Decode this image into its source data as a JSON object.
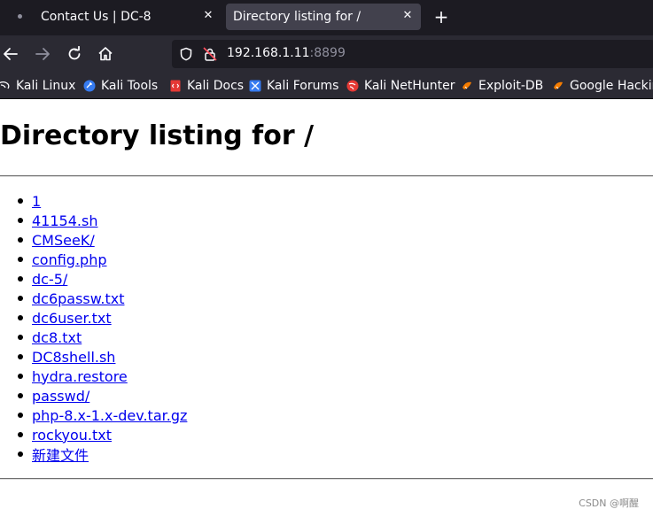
{
  "tabs": [
    {
      "label": "Contact Us | DC-8",
      "active": false
    },
    {
      "label": "Directory listing for /",
      "active": true
    }
  ],
  "nav": {
    "url_host": "192.168.1.11",
    "url_port": ":8899"
  },
  "bookmarks": [
    {
      "label": "Kali Linux",
      "icon": "kali-dragon-icon"
    },
    {
      "label": "Kali Tools",
      "icon": "kali-tools-icon"
    },
    {
      "label": "Kali Docs",
      "icon": "kali-docs-icon"
    },
    {
      "label": "Kali Forums",
      "icon": "kali-forums-icon"
    },
    {
      "label": "Kali NetHunter",
      "icon": "kali-nethunter-icon"
    },
    {
      "label": "Exploit-DB",
      "icon": "exploit-db-icon"
    },
    {
      "label": "Google Hacking",
      "icon": "google-hacking-icon"
    }
  ],
  "page": {
    "title": "Directory listing for /",
    "files": [
      "1",
      "41154.sh",
      "CMSeeK/",
      "config.php",
      "dc-5/",
      "dc6passw.txt",
      "dc6user.txt",
      "dc8.txt",
      "DC8shell.sh",
      "hydra.restore",
      "passwd/",
      "php-8.x-1.x-dev.tar.gz",
      "rockyou.txt",
      "新建文件"
    ]
  },
  "watermark": "CSDN @啊醒",
  "colors": {
    "tabbar_bg": "#1c1b22",
    "toolbar_bg": "#2b2a33",
    "active_tab_bg": "#42414d",
    "link": "#0000ee"
  }
}
